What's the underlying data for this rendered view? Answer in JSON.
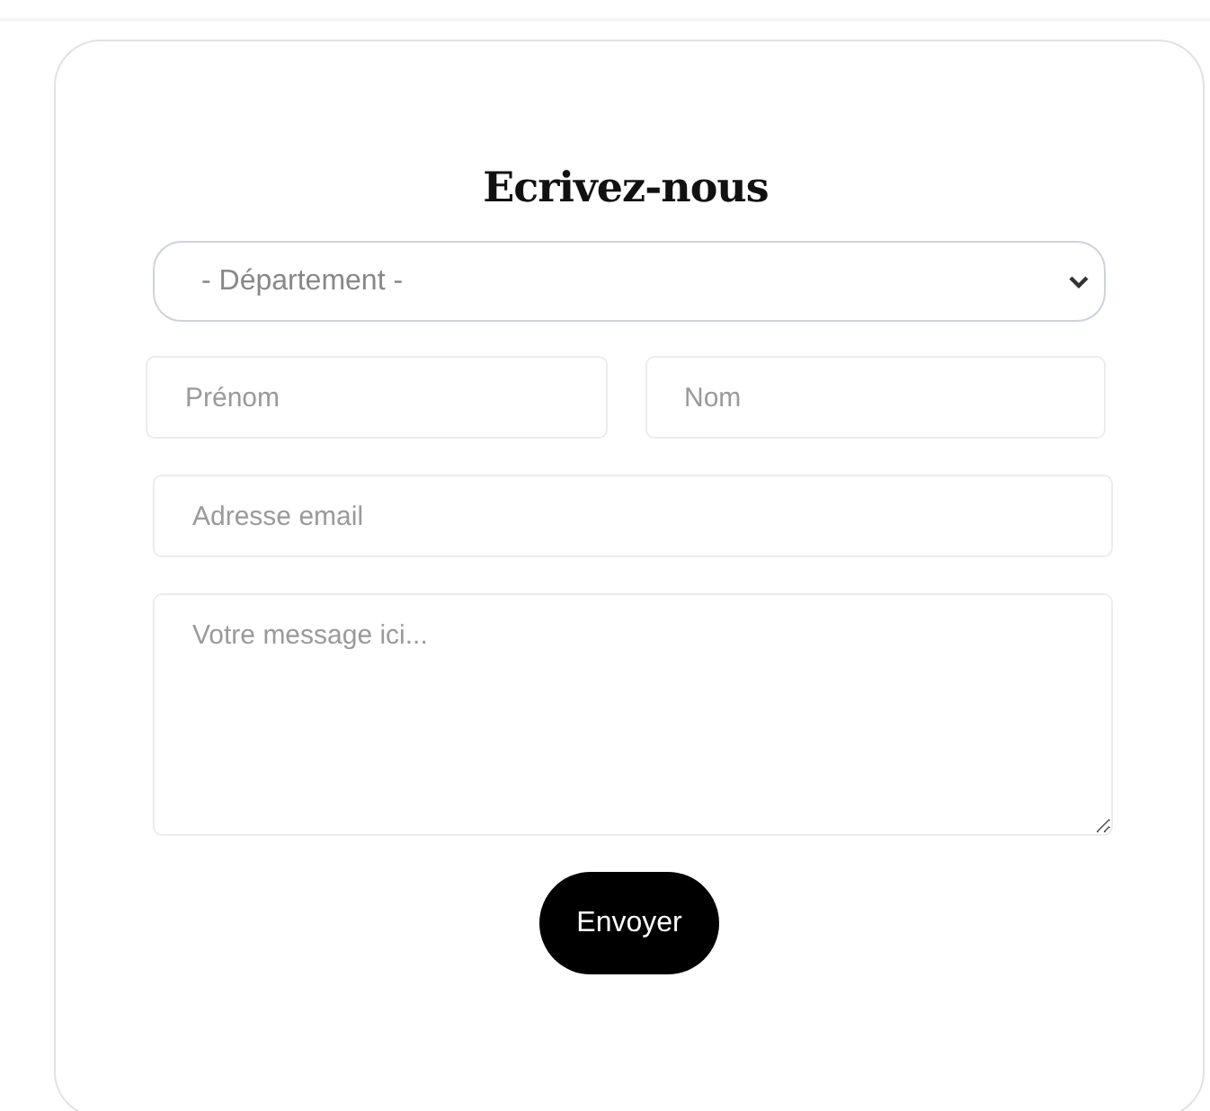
{
  "form": {
    "title": "Ecrivez-nous",
    "department": {
      "value": "- Département -"
    },
    "first_name": {
      "placeholder": "Prénom"
    },
    "last_name": {
      "placeholder": "Nom"
    },
    "email": {
      "placeholder": "Adresse email"
    },
    "message": {
      "placeholder": "Votre message ici..."
    },
    "submit": "Envoyer"
  }
}
